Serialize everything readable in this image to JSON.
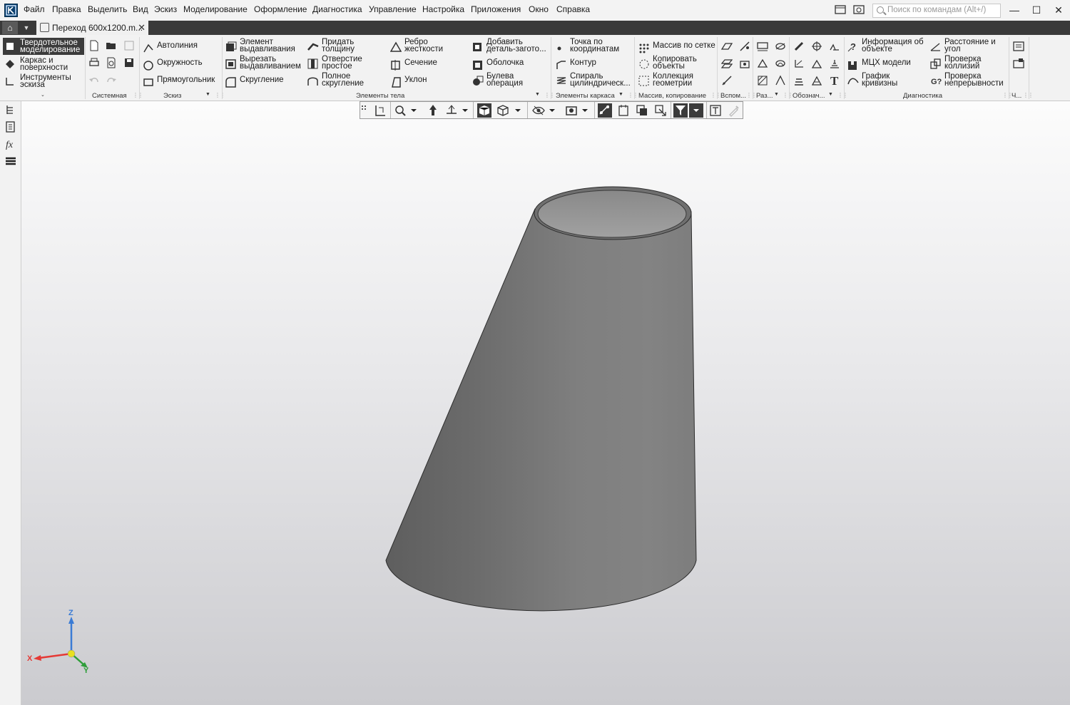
{
  "menu": [
    "Файл",
    "Правка",
    "Выделить",
    "Вид",
    "Эскиз",
    "Моделирование",
    "Оформление",
    "Диагностика",
    "Управление",
    "Настройка",
    "Приложения",
    "Окно",
    "Справка"
  ],
  "search": {
    "placeholder": "Поиск по командам (Alt+/)"
  },
  "window_controls": {
    "minimize": "—",
    "maximize": "☐",
    "close": "✕"
  },
  "document_tab": {
    "title": "Переход 600х1200.m...",
    "close": "✕"
  },
  "mode_panel": {
    "items": [
      "Твердотельное моделирование",
      "Каркас и поверхности",
      "Инструменты эскиза"
    ],
    "active": 0
  },
  "groups": {
    "system": "Системная",
    "sketch": "Эскиз",
    "body": "Элементы тела",
    "frame": "Элементы каркаса",
    "array": "Массив, копирование",
    "aux": "Вспом...",
    "size": "Раз...",
    "notation": "Обознач...",
    "diagnostics": "Диагностика",
    "other": "Ч..."
  },
  "sketch_cmds": [
    "Автолиния",
    "Окружность",
    "Прямоугольник"
  ],
  "body_cmds": {
    "extrude": [
      "Элемент",
      "выдавливания"
    ],
    "cut_extrude": [
      "Вырезать",
      "выдавливанием"
    ],
    "fillet": "Скругление",
    "thicken": [
      "Придать",
      "толщину"
    ],
    "hole": [
      "Отверстие",
      "простое"
    ],
    "full_round": [
      "Полное",
      "скругление"
    ],
    "rib": [
      "Ребро",
      "жесткости"
    ],
    "section": "Сечение",
    "draft": "Уклон",
    "add_part": [
      "Добавить",
      "деталь-загото..."
    ],
    "shell": "Оболочка",
    "boolean": [
      "Булева",
      "операция"
    ]
  },
  "frame_cmds": {
    "point": [
      "Точка по",
      "координатам"
    ],
    "contour": "Контур",
    "spiral": [
      "Спираль",
      "цилиндрическ..."
    ]
  },
  "array_cmds": {
    "grid": "Массив по сетке",
    "copy": [
      "Копировать",
      "объекты"
    ],
    "collection": [
      "Коллекция",
      "геометрии"
    ]
  },
  "diag_cmds": {
    "info": [
      "Информация об",
      "объекте"
    ],
    "mass": "МЦХ модели",
    "curvature": [
      "График",
      "кривизны"
    ],
    "distance": [
      "Расстояние и",
      "угол"
    ],
    "collision": [
      "Проверка",
      "коллизий"
    ],
    "continuity": [
      "Проверка",
      "непрерывности"
    ]
  },
  "triad": {
    "x": "X",
    "y": "Y",
    "z": "Z"
  },
  "colors": {
    "model": "#7e7e7e",
    "xaxis": "#e53935",
    "yaxis": "#2e9e3a",
    "zaxis": "#3a7bd5",
    "origin": "#e8e020"
  }
}
